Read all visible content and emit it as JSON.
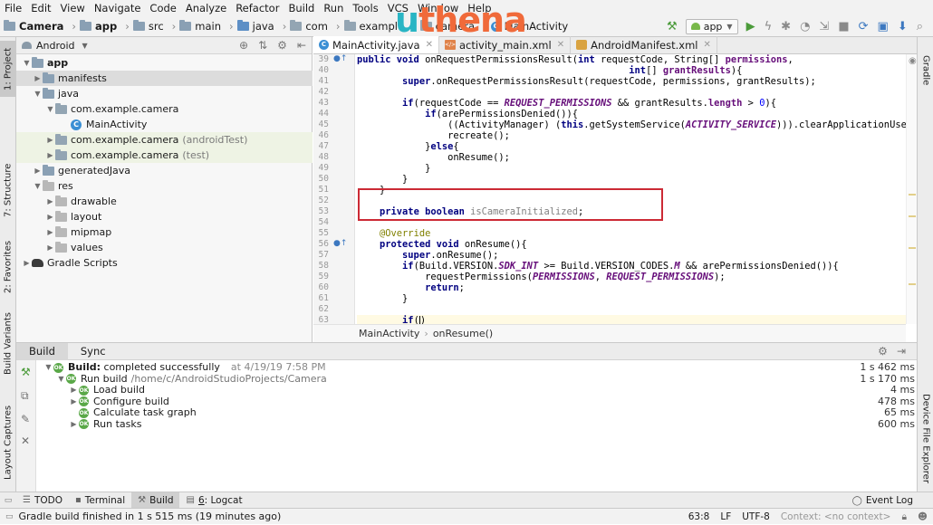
{
  "menu": [
    "File",
    "Edit",
    "View",
    "Navigate",
    "Code",
    "Analyze",
    "Refactor",
    "Build",
    "Run",
    "Tools",
    "VCS",
    "Window",
    "Help"
  ],
  "navbar": {
    "crumbs": [
      "Camera",
      "app",
      "src",
      "main",
      "java",
      "com",
      "example",
      "camera",
      "MainActivity"
    ],
    "run_config": "app"
  },
  "logo": {
    "part1": "u",
    "part2": "thena"
  },
  "left_strip": {
    "project": "1: Project",
    "structure": "7: Structure",
    "favorites": "2: Favorites",
    "build_variants": "Build Variants",
    "layout_captures": "Layout Captures"
  },
  "right_strip": {
    "gradle": "Gradle",
    "device_explorer": "Device File Explorer"
  },
  "project": {
    "view": "Android",
    "tree": [
      {
        "label": "app",
        "muted": "",
        "depth": 0
      },
      {
        "label": "manifests",
        "muted": "",
        "depth": 1
      },
      {
        "label": "java",
        "muted": "",
        "depth": 1
      },
      {
        "label": "com.example.camera",
        "muted": "",
        "depth": 2
      },
      {
        "label": "MainActivity",
        "muted": "",
        "depth": 3
      },
      {
        "label": "com.example.camera",
        "muted": "(androidTest)",
        "depth": 2
      },
      {
        "label": "com.example.camera",
        "muted": "(test)",
        "depth": 2
      },
      {
        "label": "generatedJava",
        "muted": "",
        "depth": 1
      },
      {
        "label": "res",
        "muted": "",
        "depth": 1
      },
      {
        "label": "drawable",
        "muted": "",
        "depth": 2
      },
      {
        "label": "layout",
        "muted": "",
        "depth": 2
      },
      {
        "label": "mipmap",
        "muted": "",
        "depth": 2
      },
      {
        "label": "values",
        "muted": "",
        "depth": 2
      },
      {
        "label": "Gradle Scripts",
        "muted": "",
        "depth": 0
      }
    ]
  },
  "editor": {
    "tabs": [
      "MainActivity.java",
      "activity_main.xml",
      "AndroidManifest.xml"
    ],
    "line_numbers": [
      "39",
      "40",
      "41",
      "42",
      "43",
      "44",
      "45",
      "46",
      "47",
      "48",
      "49",
      "50",
      "51",
      "52",
      "53",
      "54",
      "55",
      "56",
      "57",
      "58",
      "59",
      "60",
      "61",
      "62",
      "63",
      "64"
    ],
    "breadcrumb": [
      "MainActivity",
      "onResume()"
    ]
  },
  "build": {
    "tabs": [
      "Build",
      "Sync"
    ],
    "rows": [
      {
        "label": "Build:",
        "status": "completed successfully",
        "when": "at 4/19/19 7:58 PM",
        "time": "1 s 462 ms"
      },
      {
        "label": "Run build",
        "path": "/home/c/AndroidStudioProjects/Camera",
        "time": "1 s 170 ms"
      },
      {
        "label": "Load build",
        "time": "4 ms"
      },
      {
        "label": "Configure build",
        "time": "478 ms"
      },
      {
        "label": "Calculate task graph",
        "time": "65 ms"
      },
      {
        "label": "Run tasks",
        "time": "600 ms"
      }
    ]
  },
  "bottom_tools": {
    "todo": "TODO",
    "terminal": "Terminal",
    "build": "Build",
    "logcat_num": "6",
    "logcat": ": Logcat",
    "event_log": "Event Log"
  },
  "status": {
    "message": "Gradle build finished in 1 s 515 ms (19 minutes ago)",
    "position": "63:8",
    "line_sep": "LF",
    "encoding": "UTF-8",
    "context": "Context: <no context>"
  }
}
